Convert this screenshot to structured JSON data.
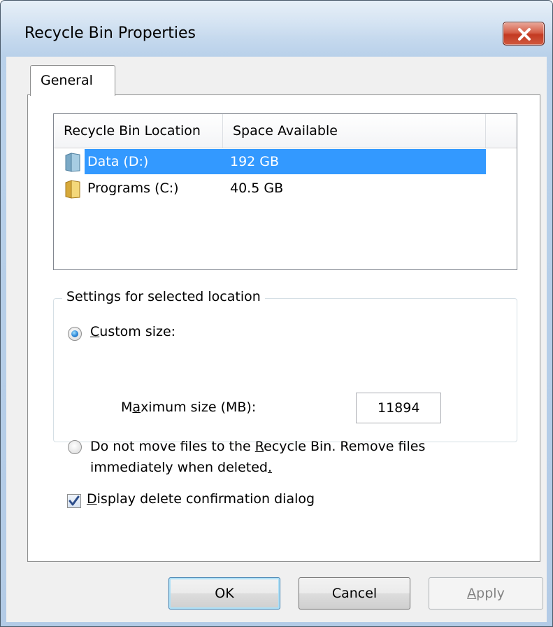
{
  "window": {
    "title": "Recycle Bin Properties"
  },
  "tabs": [
    {
      "label": "General"
    }
  ],
  "location_list": {
    "columns": [
      "Recycle Bin Location",
      "Space Available"
    ],
    "rows": [
      {
        "name": "Data (D:)",
        "space": "192 GB",
        "icon": "drive-folder-icon",
        "selected": true
      },
      {
        "name": "Programs (C:)",
        "space": "40.5 GB",
        "icon": "folder-icon",
        "selected": false
      }
    ]
  },
  "settings": {
    "group_title": "Settings for selected location",
    "custom_size": {
      "label_prefix": "",
      "label_mnemonic": "C",
      "label_rest": "ustom size:",
      "selected": true
    },
    "max_size": {
      "label_prefix": "M",
      "label_mnemonic": "a",
      "label_rest": "ximum size (MB):",
      "value": "11894"
    },
    "no_recycle": {
      "line1_prefix": "Do not move files to the ",
      "line1_mnemonic": "R",
      "line1_rest": "ecycle Bin. Remove files",
      "line2_prefix": "immediately when deleted",
      "line2_mnemonic": ".",
      "selected": false
    }
  },
  "confirm_dialog": {
    "label_mnemonic": "D",
    "label_rest": "isplay delete confirmation dialog",
    "checked": true
  },
  "buttons": {
    "ok": "OK",
    "cancel": "Cancel",
    "apply_mnemonic": "A",
    "apply_rest": "pply"
  },
  "colors": {
    "selection": "#3399ff",
    "close_button": "#c8452c"
  }
}
